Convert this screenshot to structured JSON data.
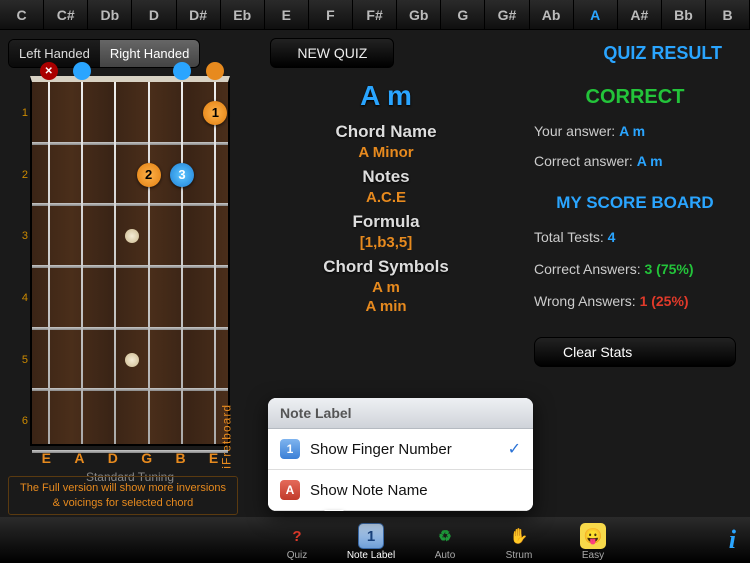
{
  "note_bar": {
    "notes": [
      "C",
      "C#",
      "Db",
      "D",
      "D#",
      "Eb",
      "E",
      "F",
      "F#",
      "Gb",
      "G",
      "G#",
      "Ab",
      "A",
      "A#",
      "Bb",
      "B"
    ],
    "active": "A"
  },
  "handed": {
    "left": "Left Handed",
    "right": "Right Handed",
    "active": "right"
  },
  "new_quiz": "NEW QUIZ",
  "quiz_result_title": "QUIZ RESULT",
  "fretboard": {
    "fret_numbers": [
      "1",
      "2",
      "3",
      "4",
      "5",
      "6"
    ],
    "open_strings": [
      "E",
      "A",
      "D",
      "G",
      "B",
      "E"
    ],
    "tuning_label": "Standard Tuning",
    "brand": "iFretboard",
    "nut": [
      "x",
      "open",
      "",
      "",
      "open",
      "orange"
    ],
    "fingers": [
      {
        "fret": 1,
        "string": 5,
        "num": "1",
        "color": "orange"
      },
      {
        "fret": 2,
        "string": 3,
        "num": "2",
        "color": "orange"
      },
      {
        "fret": 2,
        "string": 4,
        "num": "3",
        "color": "blue"
      }
    ]
  },
  "chord": {
    "big": "A m",
    "name_label": "Chord Name",
    "name_value": "A Minor",
    "notes_label": "Notes",
    "notes_value": "A.C.E",
    "formula_label": "Formula",
    "formula_value": "[1,b3,5]",
    "symbols_label": "Chord Symbols",
    "symbols": [
      "A m",
      "A min"
    ]
  },
  "score": {
    "verdict": "CORRECT",
    "your_label": "Your answer: ",
    "your_value": "A m",
    "correct_label": "Correct answer: ",
    "correct_value": "A m",
    "board_title": "MY SCORE BOARD",
    "total_label": "Total Tests: ",
    "total_value": "4",
    "ok_label": "Correct Answers: ",
    "ok_value": "3 (75%)",
    "bad_label": "Wrong Answers: ",
    "bad_value": "1 (25%)",
    "clear": "Clear Stats"
  },
  "promo": "The Full version will show more inversions & voicings for selected chord",
  "popover": {
    "title": "Note Label",
    "opt1": "Show Finger Number",
    "opt2": "Show Note Name",
    "selected": 1
  },
  "tabs": {
    "quiz": "Quiz",
    "note_label": "Note Label",
    "auto": "Auto",
    "strum": "Strum",
    "easy": "Easy"
  }
}
